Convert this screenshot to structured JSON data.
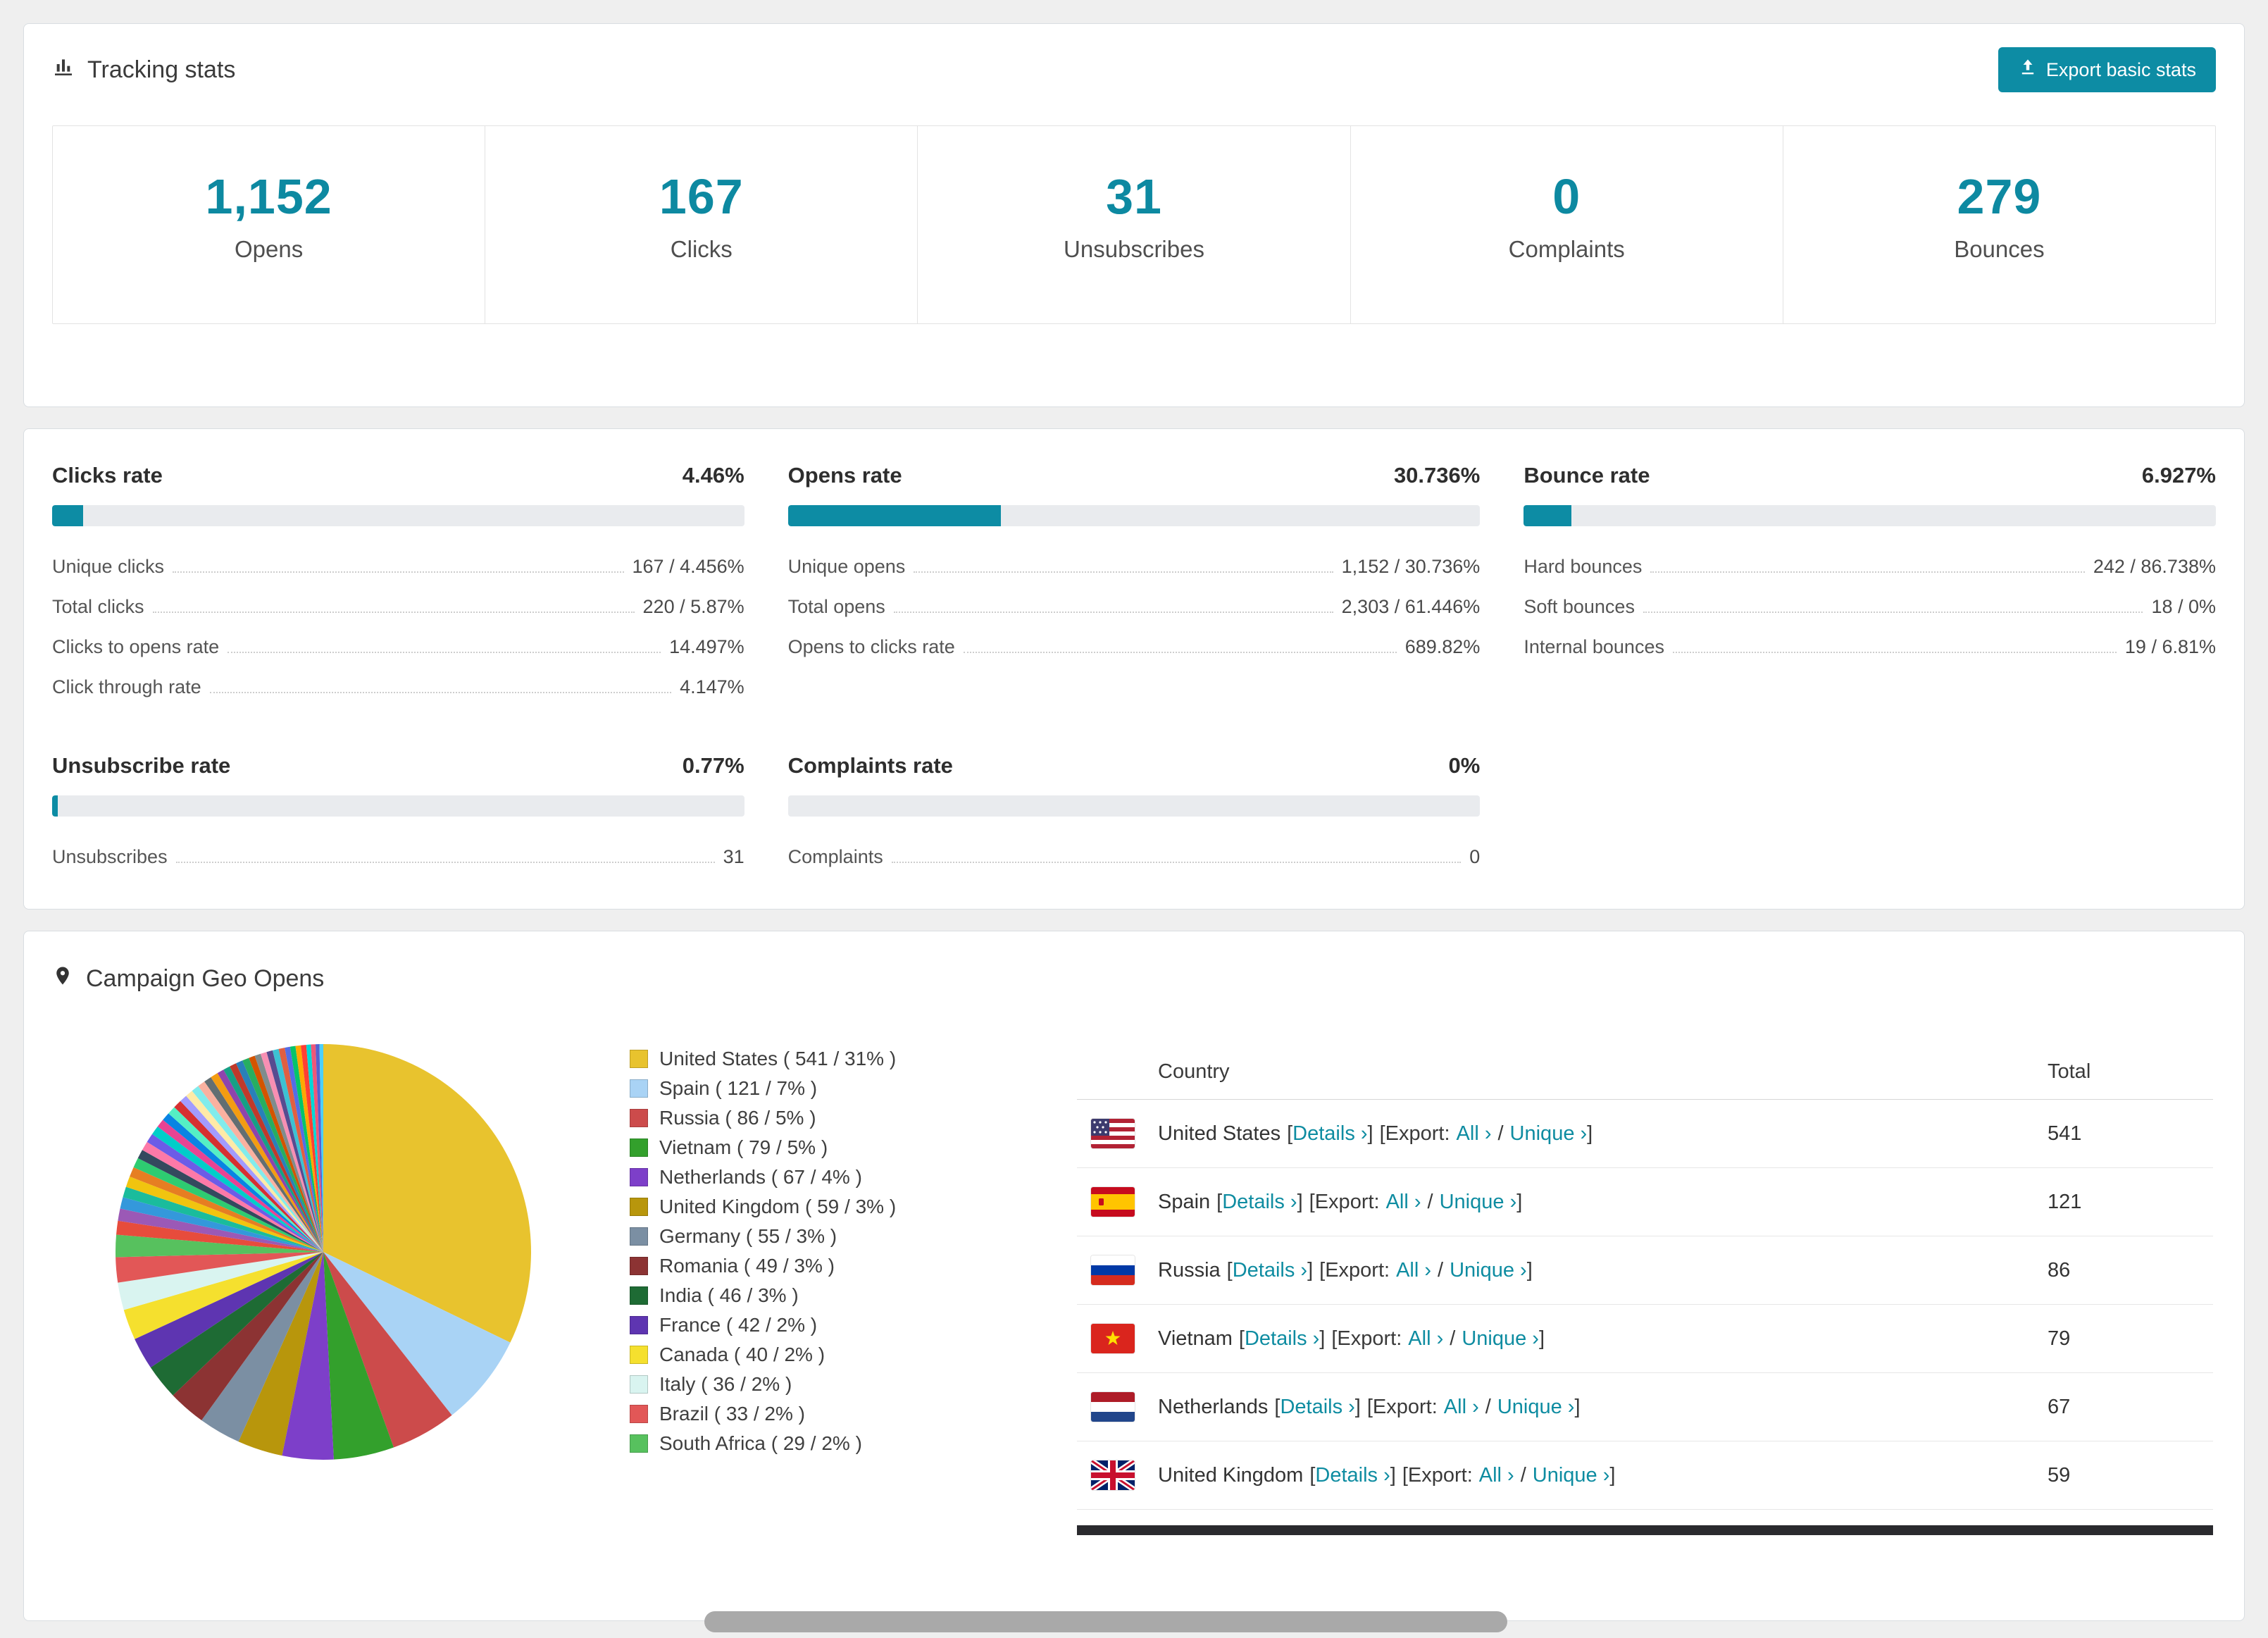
{
  "tracking": {
    "title": "Tracking stats",
    "export_label": "Export basic stats",
    "stats": [
      {
        "value": "1,152",
        "label": "Opens"
      },
      {
        "value": "167",
        "label": "Clicks"
      },
      {
        "value": "31",
        "label": "Unsubscribes"
      },
      {
        "value": "0",
        "label": "Complaints"
      },
      {
        "value": "279",
        "label": "Bounces"
      }
    ]
  },
  "colors": {
    "accent": "#0d8ca4",
    "stat_number": "#0d89a1",
    "link": "#0e8ca1"
  },
  "rates": [
    {
      "title": "Clicks rate",
      "percent": "4.46%",
      "fill": 4.46,
      "rows": [
        [
          "Unique clicks",
          "167 / 4.456%"
        ],
        [
          "Total clicks",
          "220 / 5.87%"
        ],
        [
          "Clicks to opens rate",
          "14.497%"
        ],
        [
          "Click through rate",
          "4.147%"
        ]
      ]
    },
    {
      "title": "Opens rate",
      "percent": "30.736%",
      "fill": 30.736,
      "rows": [
        [
          "Unique opens",
          "1,152 / 30.736%"
        ],
        [
          "Total opens",
          "2,303 / 61.446%"
        ],
        [
          "Opens to clicks rate",
          "689.82%"
        ]
      ]
    },
    {
      "title": "Bounce rate",
      "percent": "6.927%",
      "fill": 6.927,
      "rows": [
        [
          "Hard bounces",
          "242 / 86.738%"
        ],
        [
          "Soft bounces",
          "18 / 0%"
        ],
        [
          "Internal bounces",
          "19 / 6.81%"
        ]
      ]
    },
    {
      "title": "Unsubscribe rate",
      "percent": "0.77%",
      "fill": 0.77,
      "rows": [
        [
          "Unsubscribes",
          "31"
        ]
      ]
    },
    {
      "title": "Complaints rate",
      "percent": "0%",
      "fill": 0,
      "rows": [
        [
          "Complaints",
          "0"
        ]
      ]
    }
  ],
  "geo": {
    "title": "Campaign Geo Opens",
    "table": {
      "country_header": "Country",
      "total_header": "Total",
      "link_details": "Details ›",
      "export_label": "Export:",
      "link_all": "All ›",
      "link_unique": "Unique ›",
      "fmt": {
        "lb": "[",
        "rb": "]",
        "slash": "/"
      },
      "rows": [
        {
          "country": "United States",
          "flag": "us",
          "total": "541"
        },
        {
          "country": "Spain",
          "flag": "es",
          "total": "121"
        },
        {
          "country": "Russia",
          "flag": "ru",
          "total": "86"
        },
        {
          "country": "Vietnam",
          "flag": "vn",
          "total": "79"
        },
        {
          "country": "Netherlands",
          "flag": "nl",
          "total": "67"
        },
        {
          "country": "United Kingdom",
          "flag": "gb",
          "total": "59"
        }
      ]
    }
  },
  "chart_data": {
    "type": "pie",
    "title": "Campaign Geo Opens",
    "legend_position": "right",
    "slices": [
      {
        "label": "United States",
        "value": 541,
        "pct": "31%",
        "color": "#e8c32e"
      },
      {
        "label": "Spain",
        "value": 121,
        "pct": "7%",
        "color": "#a9d3f5"
      },
      {
        "label": "Russia",
        "value": 86,
        "pct": "5%",
        "color": "#cc4b4b"
      },
      {
        "label": "Vietnam",
        "value": 79,
        "pct": "5%",
        "color": "#33a02c"
      },
      {
        "label": "Netherlands",
        "value": 67,
        "pct": "4%",
        "color": "#7d3fc9"
      },
      {
        "label": "United Kingdom",
        "value": 59,
        "pct": "3%",
        "color": "#b8960c"
      },
      {
        "label": "Germany",
        "value": 55,
        "pct": "3%",
        "color": "#7b8fa3"
      },
      {
        "label": "Romania",
        "value": 49,
        "pct": "3%",
        "color": "#8c3333"
      },
      {
        "label": "India",
        "value": 46,
        "pct": "3%",
        "color": "#1e6b34"
      },
      {
        "label": "France",
        "value": 42,
        "pct": "2%",
        "color": "#5e35b1"
      },
      {
        "label": "Canada",
        "value": 40,
        "pct": "2%",
        "color": "#f5e02e"
      },
      {
        "label": "Italy",
        "value": 36,
        "pct": "2%",
        "color": "#d9f4f0"
      },
      {
        "label": "Brazil",
        "value": 33,
        "pct": "2%",
        "color": "#e25757"
      },
      {
        "label": "South Africa",
        "value": 29,
        "pct": "2%",
        "color": "#57c15e"
      }
    ],
    "others": [
      [
        18,
        "#e74c3c"
      ],
      [
        16,
        "#9b59b6"
      ],
      [
        15,
        "#3498db"
      ],
      [
        14,
        "#1abc9c"
      ],
      [
        14,
        "#f1c40f"
      ],
      [
        13,
        "#e67e22"
      ],
      [
        13,
        "#2ecc71"
      ],
      [
        12,
        "#34495e"
      ],
      [
        12,
        "#fd79a8"
      ],
      [
        12,
        "#6c5ce7"
      ],
      [
        12,
        "#00cec9"
      ],
      [
        11,
        "#e84393"
      ],
      [
        11,
        "#0984e3"
      ],
      [
        11,
        "#55efc4"
      ],
      [
        11,
        "#d63031"
      ],
      [
        10,
        "#a29bfe"
      ],
      [
        10,
        "#ffeaa7"
      ],
      [
        10,
        "#81ecec"
      ],
      [
        10,
        "#fab1a0"
      ],
      [
        10,
        "#636e72"
      ],
      [
        10,
        "#f39c12"
      ],
      [
        9,
        "#8e44ad"
      ],
      [
        9,
        "#16a085"
      ],
      [
        9,
        "#c0392b"
      ],
      [
        9,
        "#2980b9"
      ],
      [
        9,
        "#27ae60"
      ],
      [
        8,
        "#d35400"
      ],
      [
        8,
        "#7f8c8d"
      ],
      [
        8,
        "#f78fb3"
      ],
      [
        8,
        "#574b90"
      ],
      [
        8,
        "#3dc1d3"
      ],
      [
        8,
        "#e15f41"
      ],
      [
        7,
        "#546de5"
      ],
      [
        7,
        "#05c46b"
      ],
      [
        7,
        "#ffa801"
      ],
      [
        7,
        "#ff3f34"
      ],
      [
        6,
        "#00d8d6"
      ],
      [
        6,
        "#ef5777"
      ],
      [
        5,
        "#575fcf"
      ],
      [
        5,
        "#4bcffa"
      ]
    ]
  }
}
